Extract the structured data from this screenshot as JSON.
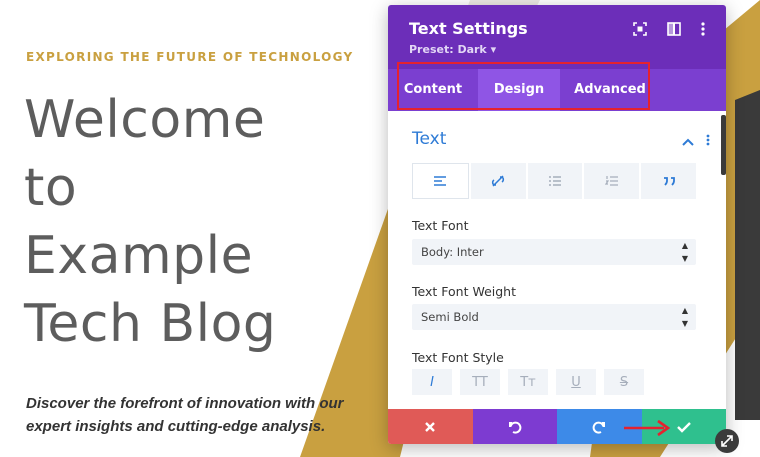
{
  "page": {
    "eyebrow": "EXPLORING THE FUTURE OF TECHNOLOGY",
    "title_lines": [
      "Welcome",
      "to",
      "Example",
      "Tech Blog"
    ],
    "subtitle_lines": [
      "Discover the forefront of innovation with our",
      "expert insights and cutting-edge analysis."
    ]
  },
  "modal": {
    "title": "Text Settings",
    "preset": "Preset: Dark ▾",
    "tabs": [
      {
        "label": "Content",
        "active": false
      },
      {
        "label": "Design",
        "active": true
      },
      {
        "label": "Advanced",
        "active": false
      }
    ],
    "group_title": "Text",
    "alignment_buttons": [
      "align-left-icon",
      "link-off-icon",
      "unordered-list-icon",
      "ordered-list-icon",
      "quote-icon"
    ],
    "fields": {
      "font_label": "Text Font",
      "font_value": "Body: Inter",
      "weight_label": "Text Font Weight",
      "weight_value": "Semi Bold",
      "style_label": "Text Font Style"
    },
    "style_buttons": [
      {
        "label": "I",
        "active": true
      },
      {
        "label": "TT",
        "active": false
      },
      {
        "label": "Tт",
        "active": false
      },
      {
        "label": "U",
        "active": false
      },
      {
        "label": "S",
        "active": false
      }
    ]
  },
  "colors": {
    "header": "#6c2eb9",
    "tabs_bar": "#7b3fd0",
    "active_tab": "#8f55e5",
    "accent_blue": "#2e7bd6",
    "gold": "#c9a040",
    "footer_close": "#e05a57",
    "footer_undo": "#7d3bd1",
    "footer_redo": "#3d8ae8",
    "footer_save": "#2fc08e",
    "highlight_red": "#e5222f"
  }
}
